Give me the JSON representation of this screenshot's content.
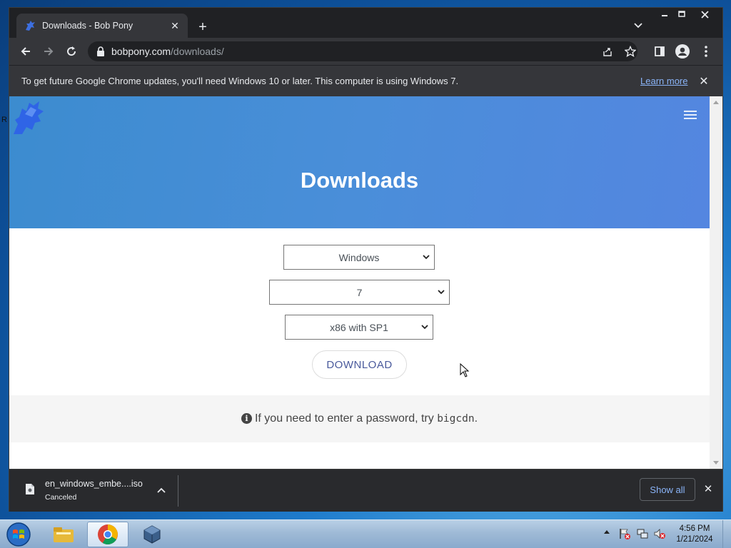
{
  "browser": {
    "tab_title": "Downloads - Bob Pony",
    "url_host": "bobpony.com",
    "url_path": "/downloads/"
  },
  "infobar": {
    "message": "To get future Google Chrome updates, you'll need Windows 10 or later. This computer is using Windows 7.",
    "learn_more": "Learn more"
  },
  "page": {
    "title": "Downloads",
    "selects": {
      "os": "Windows",
      "version": "7",
      "edition": "x86 with SP1"
    },
    "download_button": "DOWNLOAD",
    "hint_prefix": "If you need to enter a password, try ",
    "hint_password": "bigcdn",
    "hint_suffix": "."
  },
  "download_bar": {
    "file_name": "en_windows_embe....iso",
    "status": "Canceled",
    "show_all": "Show all"
  },
  "taskbar": {
    "time": "4:56 PM",
    "date": "1/21/2024"
  },
  "desktop": {
    "edge_letter": "R"
  },
  "colors": {
    "hero_gradient_start": "#3c8ccf",
    "hero_gradient_end": "#5486e0",
    "chrome_dark": "#202124",
    "link_blue": "#8ab4f8"
  }
}
